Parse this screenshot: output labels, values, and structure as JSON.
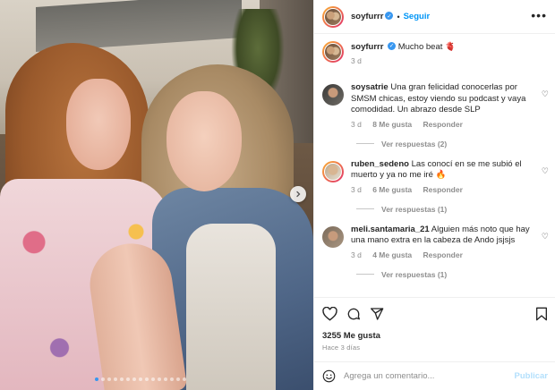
{
  "post": {
    "username": "soyfurrr",
    "follow_label": "Seguir",
    "separator": "•",
    "more_label": "•••",
    "caption_text": "Mucho beat 🫀",
    "caption_time": "3 d"
  },
  "comments": [
    {
      "username": "soysatrie",
      "text": "Una gran felicidad conocerlas por SMSM chicas, estoy viendo su podcast y vaya comodidad. Un abrazo desde SLP",
      "time": "3 d",
      "likes": "8 Me gusta",
      "reply": "Responder",
      "view_replies": "Ver respuestas (2)"
    },
    {
      "username": "ruben_sedeno",
      "text": "Las conocí en se me subió el muerto y ya no me iré 🔥",
      "time": "3 d",
      "likes": "6 Me gusta",
      "reply": "Responder",
      "view_replies": "Ver respuestas (1)"
    },
    {
      "username": "meli.santamaria_21",
      "text": "Alguien más noto que hay una mano extra en la cabeza de Ando jsjsjs",
      "time": "3 d",
      "likes": "4 Me gusta",
      "reply": "Responder",
      "view_replies": "Ver respuestas (1)"
    }
  ],
  "footer": {
    "likes_count": "3255 Me gusta",
    "time_ago": "Hace 3 días",
    "comment_placeholder": "Agrega un comentario...",
    "publish_label": "Publicar"
  },
  "carousel": {
    "slide_count": 15,
    "active_index": 0
  },
  "colors": {
    "accent": "#0095f6",
    "verified": "#3897f0",
    "muted": "#8e8e8e",
    "publish_disabled": "#b2dffc"
  },
  "icons": [
    "verified-badge-icon",
    "more-options-icon",
    "next-arrow-icon",
    "heart-icon",
    "comment-icon",
    "share-icon",
    "bookmark-icon",
    "emoji-icon"
  ]
}
